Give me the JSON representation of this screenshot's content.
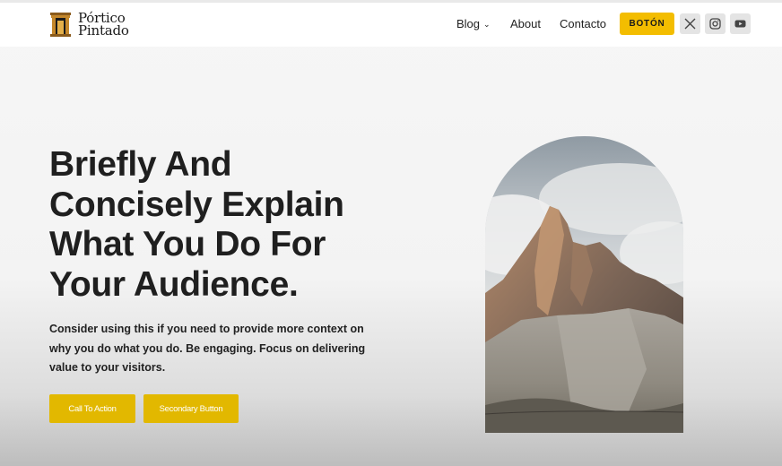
{
  "header": {
    "logo": {
      "line1": "Pórtico",
      "line2": "Pintado",
      "icon": "temple-icon"
    },
    "nav": [
      {
        "label": "Blog",
        "icon": "chevron-down-icon"
      },
      {
        "label": "About"
      },
      {
        "label": "Contacto"
      }
    ],
    "button_label": "BOTÓN",
    "social": [
      {
        "icon": "x-icon"
      },
      {
        "icon": "instagram-icon"
      },
      {
        "icon": "youtube-icon"
      }
    ]
  },
  "hero": {
    "title": "Briefly And Concisely Explain What You Do For Your Audience.",
    "text": "Consider using this if you need to provide more context on why you do what you do. Be engaging. Focus on delivering value to your visitors.",
    "primary_button": "Call To Action",
    "secondary_button": "Secondary Button",
    "image": "mountain-peak-image"
  },
  "colors": {
    "accent": "#f3bd00",
    "cta": "#e2b800",
    "text": "#1f1f1f",
    "header_bg": "#ffffff"
  }
}
